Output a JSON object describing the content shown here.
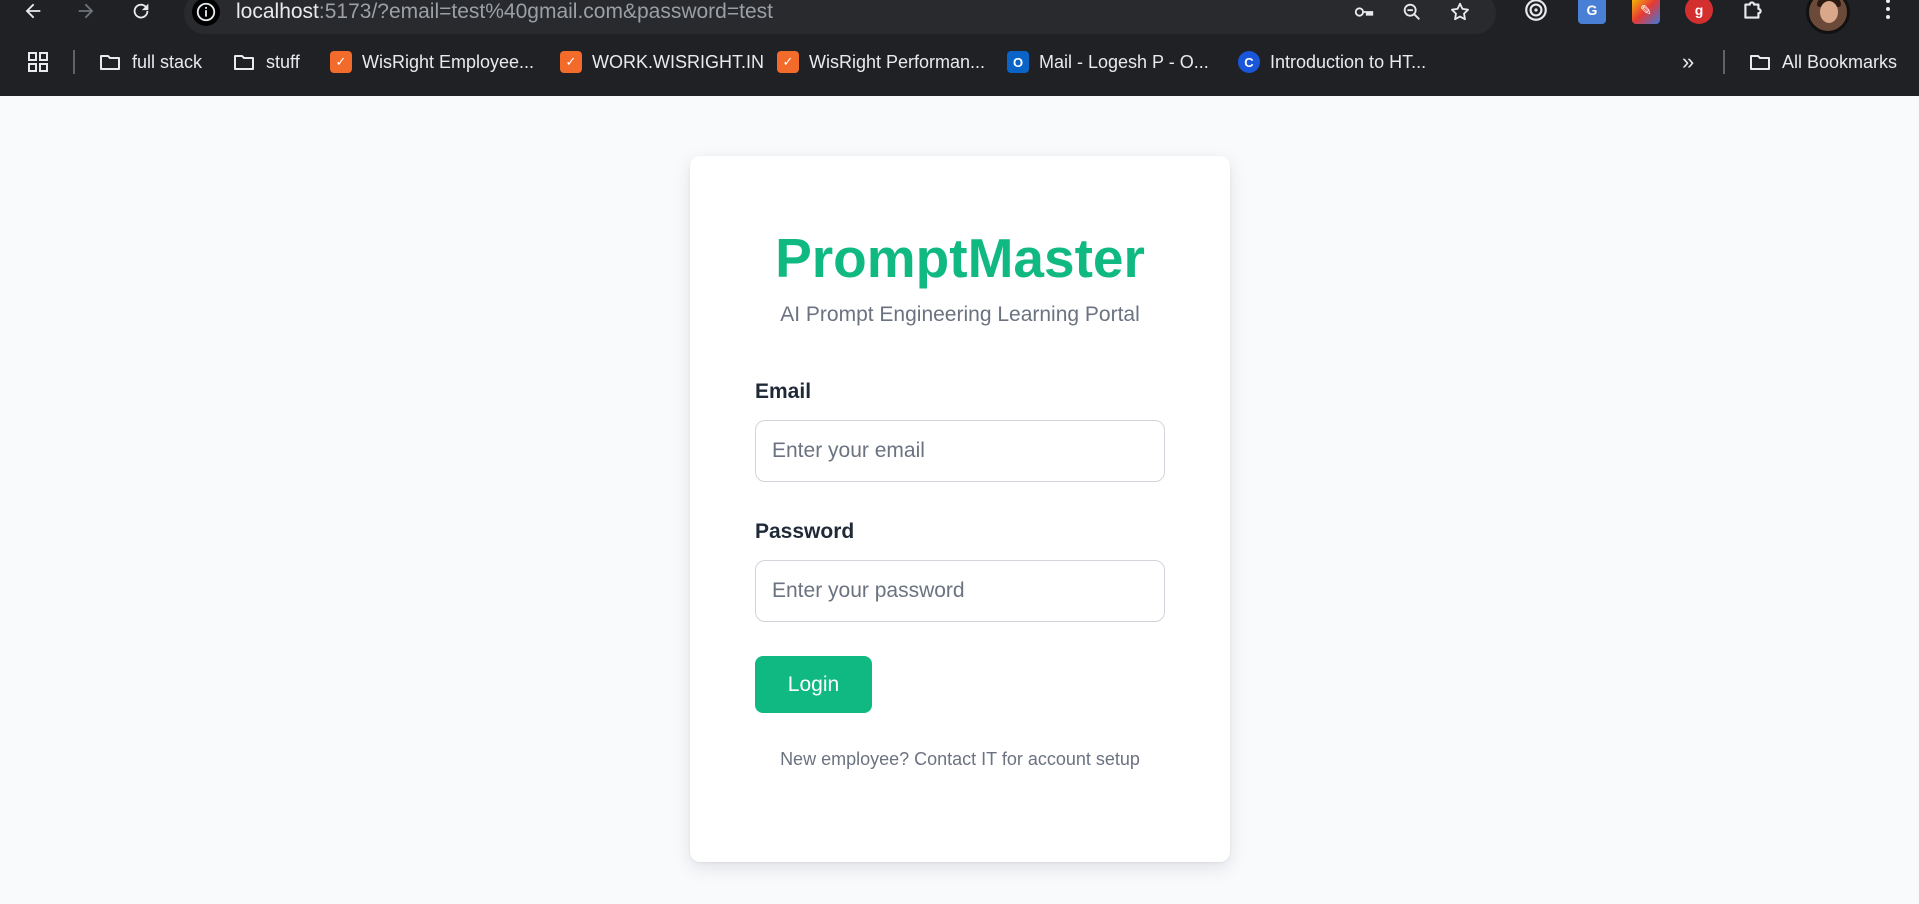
{
  "browser": {
    "url_host": "localhost",
    "url_rest": ":5173/?email=test%40gmail.com&password=test",
    "bookmarks": [
      {
        "label": "full stack",
        "icon": "folder-icon"
      },
      {
        "label": "stuff",
        "icon": "folder-icon"
      },
      {
        "label": "WisRight Employee...",
        "icon": "wisright-icon"
      },
      {
        "label": "WORK.WISRIGHT.IN",
        "icon": "wisright-icon"
      },
      {
        "label": "WisRight Performan...",
        "icon": "wisright-icon"
      },
      {
        "label": "Mail - Logesh P - O...",
        "icon": "outlook-icon"
      },
      {
        "label": "Introduction to HT...",
        "icon": "c-logo-icon"
      }
    ],
    "all_bookmarks_label": "All Bookmarks",
    "overflow_label": "»"
  },
  "login": {
    "brand": "PromptMaster",
    "subtitle": "AI Prompt Engineering Learning Portal",
    "email_label": "Email",
    "email_placeholder": "Enter your email",
    "email_value": "",
    "password_label": "Password",
    "password_placeholder": "Enter your password",
    "password_value": "",
    "login_button": "Login",
    "footnote": "New employee? Contact IT for account setup"
  },
  "colors": {
    "accent": "#10b981",
    "page_bg": "#f8fafc",
    "chrome_bg": "#202124"
  }
}
